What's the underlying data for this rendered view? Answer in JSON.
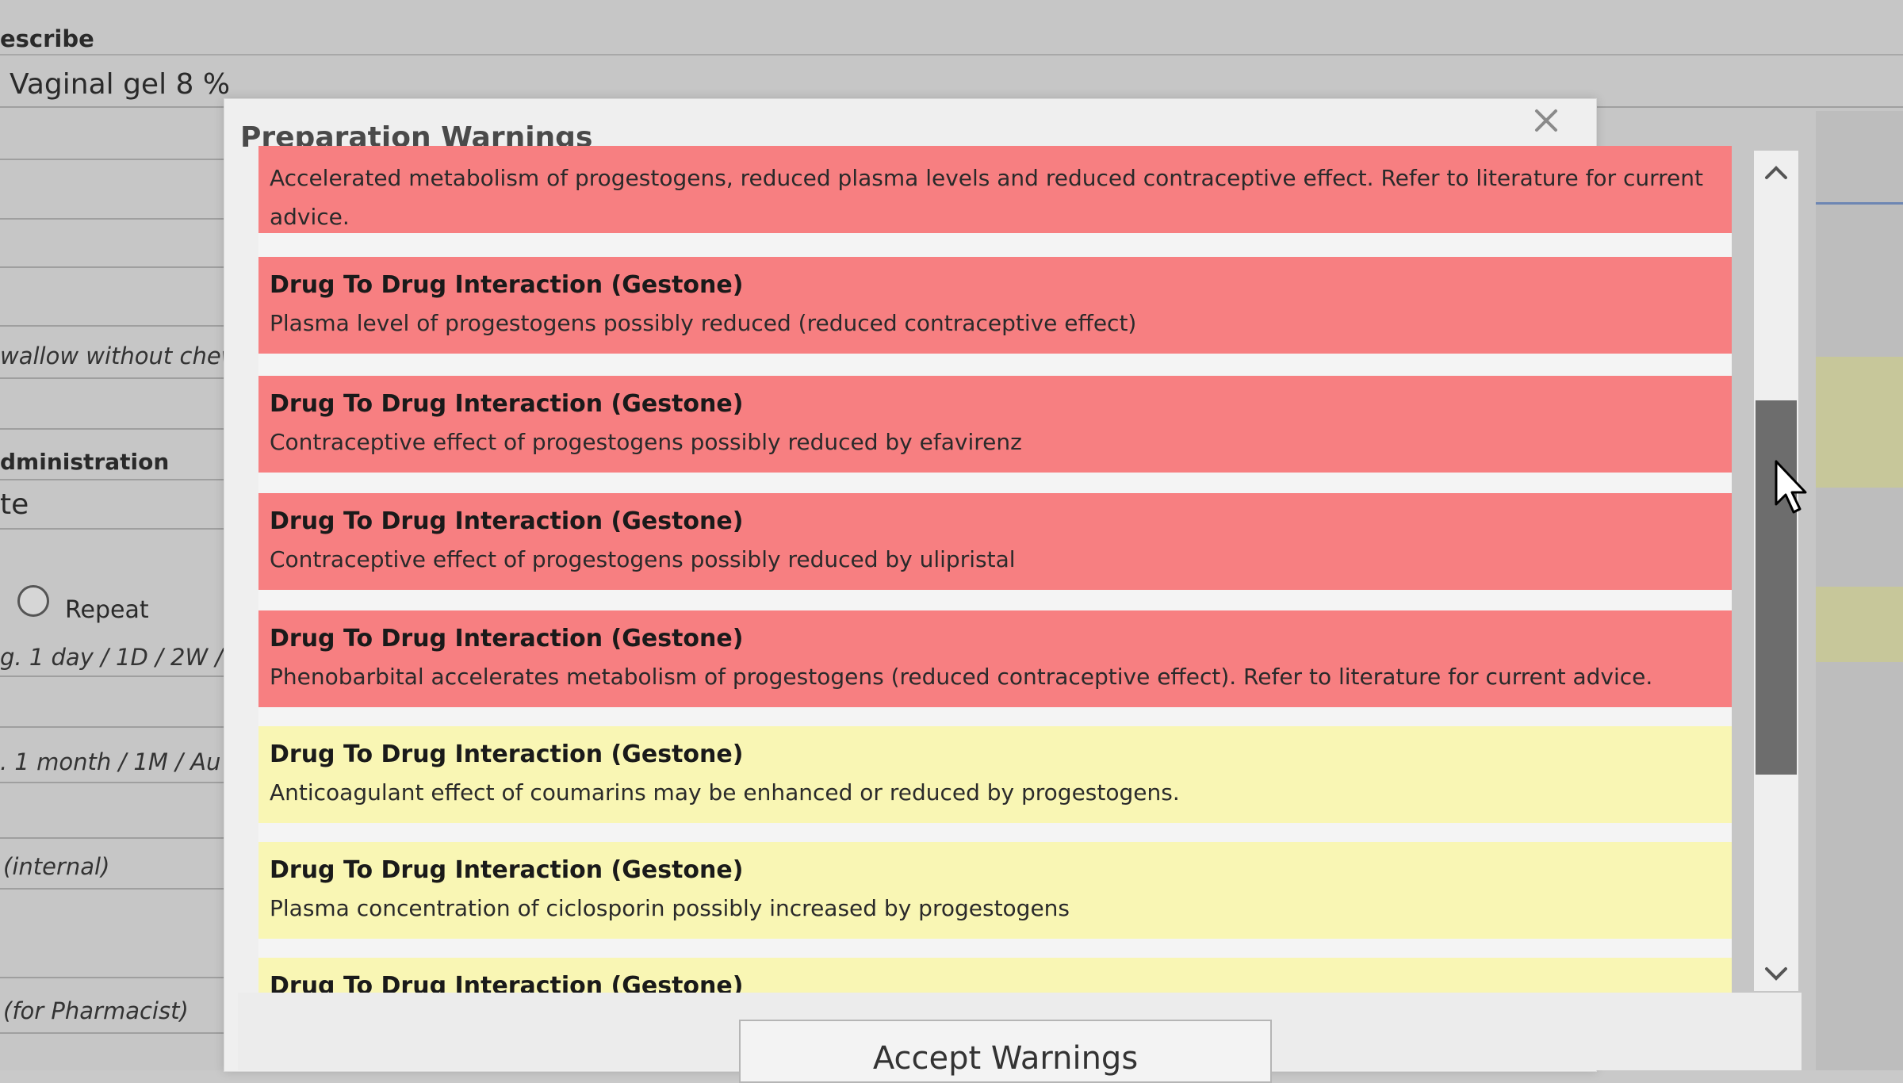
{
  "background": {
    "title": "escribe",
    "drug": "Vaginal gel  8 %",
    "swallow": "wallow without chew",
    "administration": "dministration",
    "te": "te",
    "repeat": "Repeat",
    "eg_day": "g. 1 day / 1D / 2W /",
    "eg_month": ". 1 month / 1M / Au",
    "internal": "(internal)",
    "for_pharmacist": "(for Pharmacist)"
  },
  "dialog": {
    "title": "Preparation Warnings",
    "close_icon": "close-icon",
    "accept_label": "Accept Warnings",
    "scroll_position": 0.3
  },
  "warnings": [
    {
      "severity": "red",
      "title": "",
      "desc": "Accelerated metabolism of progestogens, reduced plasma levels and reduced contraceptive effect. Refer to literature for current advice."
    },
    {
      "severity": "red",
      "title": "Drug To Drug Interaction (Gestone)",
      "desc": "Plasma level of progestogens possibly reduced (reduced contraceptive effect)"
    },
    {
      "severity": "red",
      "title": "Drug To Drug Interaction (Gestone)",
      "desc": "Contraceptive effect of progestogens possibly reduced by efavirenz"
    },
    {
      "severity": "red",
      "title": "Drug To Drug Interaction (Gestone)",
      "desc": "Contraceptive effect of progestogens possibly reduced by ulipristal"
    },
    {
      "severity": "red",
      "title": "Drug To Drug Interaction (Gestone)",
      "desc": "Phenobarbital accelerates metabolism of progestogens (reduced contraceptive effect). Refer to literature for current advice."
    },
    {
      "severity": "yellow",
      "title": "Drug To Drug Interaction (Gestone)",
      "desc": "Anticoagulant effect of coumarins may be enhanced or reduced by progestogens."
    },
    {
      "severity": "yellow",
      "title": "Drug To Drug Interaction (Gestone)",
      "desc": "Plasma concentration of ciclosporin possibly increased by progestogens"
    },
    {
      "severity": "yellow",
      "title": "Drug To Drug Interaction (Gestone)",
      "desc": ""
    }
  ],
  "colors": {
    "red": "#f77f81",
    "yellow": "#f9f6b4"
  }
}
